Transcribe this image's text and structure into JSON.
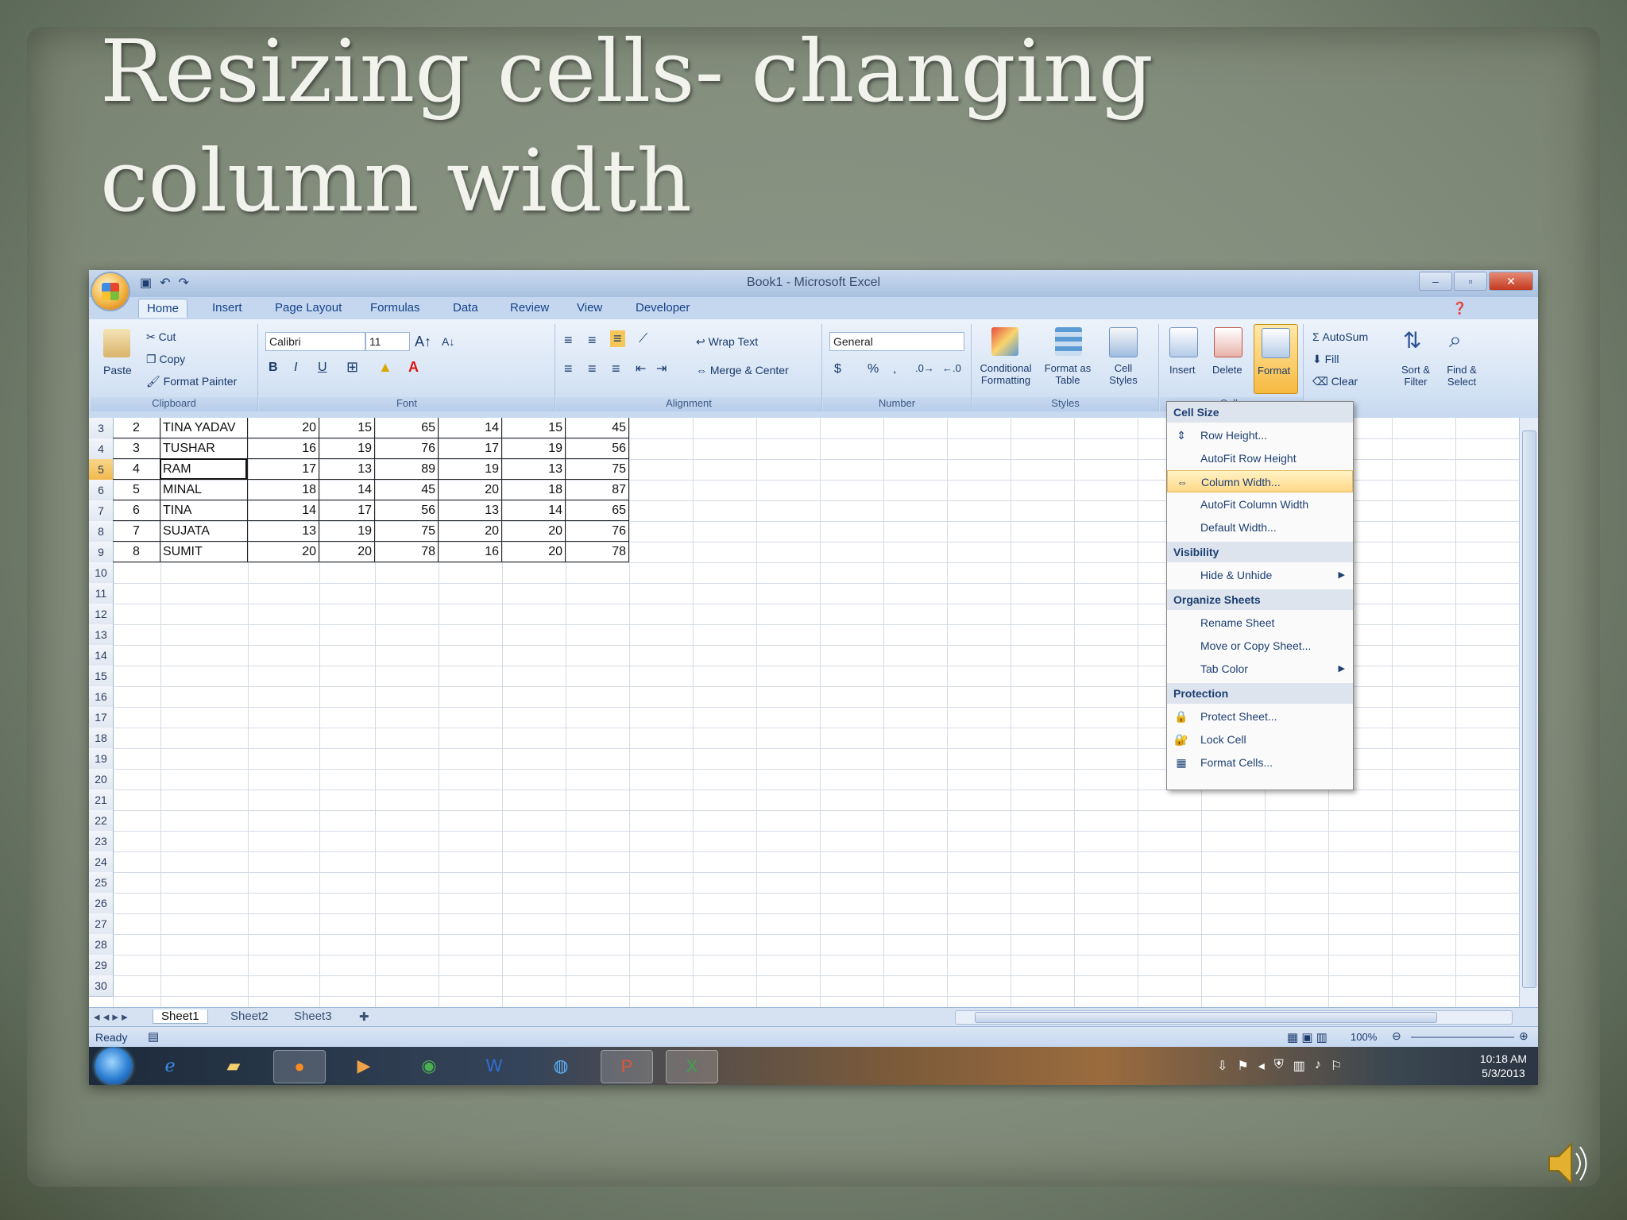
{
  "slide": {
    "title": "Resizing cells- changing column width"
  },
  "window": {
    "title": "Book1 - Microsoft Excel",
    "controls": [
      "–",
      "▫",
      "✕"
    ]
  },
  "ribbon": {
    "tabs": [
      "Home",
      "Insert",
      "Page Layout",
      "Formulas",
      "Data",
      "Review",
      "View",
      "Developer"
    ],
    "active_tab": "Home",
    "clipboard": {
      "paste": "Paste",
      "cut": "Cut",
      "copy": "Copy",
      "format_painter": "Format Painter",
      "label": "Clipboard"
    },
    "font": {
      "family": "Calibri",
      "size": "11",
      "bold": "B",
      "italic": "I",
      "underline": "U",
      "label": "Font"
    },
    "alignment": {
      "wrap_text": "Wrap Text",
      "merge_center": "Merge & Center",
      "label": "Alignment"
    },
    "number": {
      "format": "General",
      "currency": "$",
      "percent": "%",
      "label": "Number"
    },
    "styles": {
      "conditional": "Conditional Formatting",
      "format_table": "Format as Table",
      "cell_styles": "Cell Styles",
      "label": "Styles"
    },
    "cells": {
      "insert": "Insert",
      "delete": "Delete",
      "format": "Format",
      "label": "Cells"
    },
    "editing": {
      "autosum": "AutoSum",
      "fill": "Fill",
      "clear": "Clear",
      "sort_filter": "Sort & Filter",
      "find_select": "Find & Select"
    }
  },
  "sheet": {
    "rows": [
      {
        "num": "3",
        "cells": [
          "2",
          "TINA YADAV",
          "20",
          "15",
          "65",
          "14",
          "15",
          "45"
        ]
      },
      {
        "num": "4",
        "cells": [
          "3",
          "TUSHAR",
          "16",
          "19",
          "76",
          "17",
          "19",
          "56"
        ]
      },
      {
        "num": "5",
        "cells": [
          "4",
          "RAM",
          "17",
          "13",
          "89",
          "19",
          "13",
          "75"
        ]
      },
      {
        "num": "6",
        "cells": [
          "5",
          "MINAL",
          "18",
          "14",
          "45",
          "20",
          "18",
          "87"
        ]
      },
      {
        "num": "7",
        "cells": [
          "6",
          "TINA",
          "14",
          "17",
          "56",
          "13",
          "14",
          "65"
        ]
      },
      {
        "num": "8",
        "cells": [
          "7",
          "SUJATA",
          "13",
          "19",
          "75",
          "20",
          "20",
          "76"
        ]
      },
      {
        "num": "9",
        "cells": [
          "8",
          "SUMIT",
          "20",
          "20",
          "78",
          "16",
          "20",
          "78"
        ]
      }
    ],
    "empty_rows": [
      "10",
      "11",
      "12",
      "13",
      "14",
      "15",
      "16",
      "17",
      "18",
      "19",
      "20",
      "21",
      "22",
      "23",
      "24",
      "25",
      "26",
      "27",
      "28",
      "29",
      "30"
    ],
    "selected_row": "5",
    "tabs": [
      "Sheet1",
      "Sheet2",
      "Sheet3"
    ],
    "active_tab": "Sheet1"
  },
  "status": {
    "text": "Ready",
    "zoom": "100%"
  },
  "taskbar": {
    "time": "10:18 AM",
    "date": "5/3/2013"
  },
  "format_menu": {
    "sections": [
      {
        "heading": "Cell Size",
        "items": [
          {
            "label": "Row Height...",
            "icon": "row-height-icon"
          },
          {
            "label": "AutoFit Row Height",
            "icon": ""
          },
          {
            "label": "Column Width...",
            "icon": "column-width-icon",
            "highlighted": true
          },
          {
            "label": "AutoFit Column Width",
            "icon": ""
          },
          {
            "label": "Default Width...",
            "icon": ""
          }
        ]
      },
      {
        "heading": "Visibility",
        "items": [
          {
            "label": "Hide & Unhide",
            "icon": "",
            "submenu": true
          }
        ]
      },
      {
        "heading": "Organize Sheets",
        "items": [
          {
            "label": "Rename Sheet",
            "icon": ""
          },
          {
            "label": "Move or Copy Sheet...",
            "icon": ""
          },
          {
            "label": "Tab Color",
            "icon": "",
            "submenu": true
          }
        ]
      },
      {
        "heading": "Protection",
        "items": [
          {
            "label": "Protect Sheet...",
            "icon": "protect-sheet-icon"
          },
          {
            "label": "Lock Cell",
            "icon": "lock-icon"
          },
          {
            "label": "Format Cells...",
            "icon": "format-cells-icon"
          }
        ]
      }
    ]
  },
  "colors": {
    "accent": "#f2b94d",
    "ribbon": "#d8e5f5",
    "menu_highlight": "#ffd98a"
  }
}
